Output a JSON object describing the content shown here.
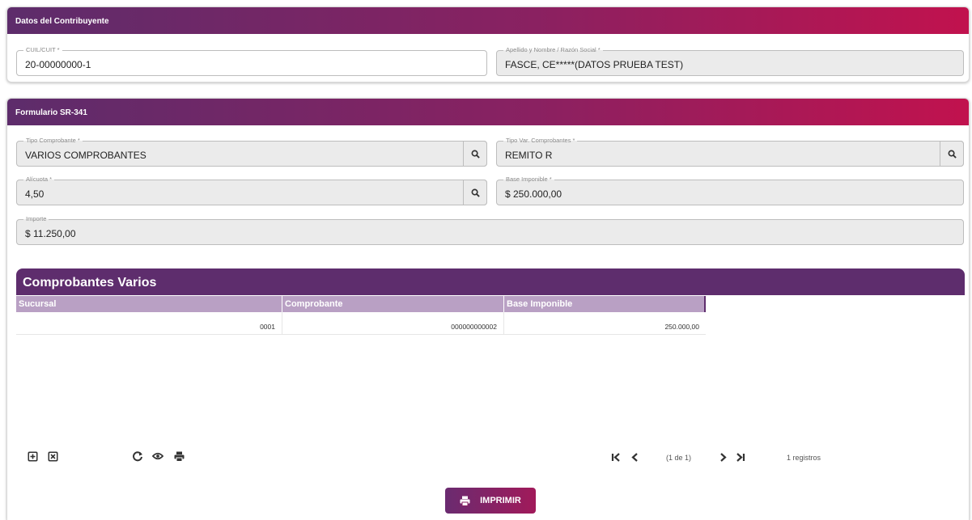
{
  "taxpayer": {
    "header": "Datos del Contribuyente",
    "cuit_label": "CUIL/CUIT *",
    "cuit_value": "20-00000000-1",
    "name_label": "Apellido y Nombre / Razón Social *",
    "name_value": "FASCE, CE*****(DATOS PRUEBA TEST)"
  },
  "form": {
    "header": "Formulario SR-341",
    "tipo_comprobante_label": "Tipo Comprobante *",
    "tipo_comprobante_value": "VARIOS COMPROBANTES",
    "tipo_var_label": "Tipo Var. Comprobantes *",
    "tipo_var_value": "REMITO R",
    "alicuota_label": "Alícuota *",
    "alicuota_value": "4,50",
    "base_label": "Base Imponible *",
    "base_value": "$ 250.000,00",
    "importe_label": "Importe",
    "importe_value": "$ 11.250,00"
  },
  "table": {
    "title": "Comprobantes Varios",
    "columns": [
      "Sucursal",
      "Comprobante",
      "Base Imponible"
    ],
    "rows": [
      [
        "0001",
        "000000000002",
        "250.000,00"
      ]
    ]
  },
  "pager": {
    "page_text": "(1 de 1)",
    "records_text": "1 registros"
  },
  "icons": {
    "lookup": "search-icon",
    "add": "plus-square-icon",
    "remove": "x-square-icon",
    "refresh": "refresh-icon",
    "view": "eye-icon",
    "print": "printer-icon"
  },
  "actions": {
    "print_label": "IMPRIMIR"
  },
  "colors": {
    "brand_purple": "#5e2d6d",
    "brand_magenta": "#c1124e",
    "table_header": "#b9a0c4"
  }
}
